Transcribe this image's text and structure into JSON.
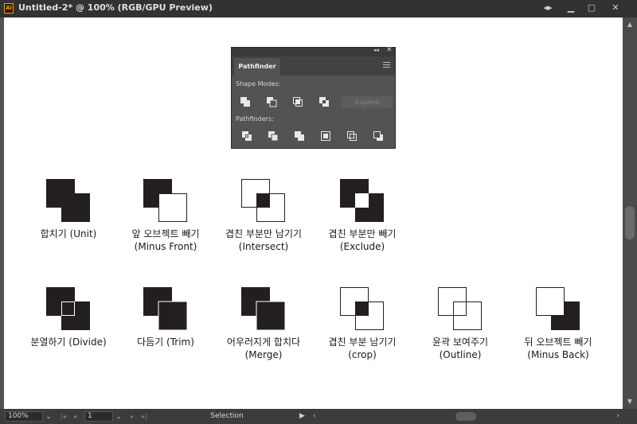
{
  "window": {
    "title": "Untitled-2* @ 100% (RGB/GPU Preview)",
    "app_icon": "Ai",
    "controls": {
      "back": "back-arrows-icon",
      "minimize": "minimize-icon",
      "maximize": "maximize-icon",
      "close": "close-icon"
    }
  },
  "pathfinder": {
    "tab": "Pathfinder",
    "shape_modes_label": "Shape Modes:",
    "pathfinders_label": "Pathfinders:",
    "expand_label": "Expand",
    "shape_mode_buttons": [
      "unite-icon",
      "minus-front-icon",
      "intersect-icon",
      "exclude-icon"
    ],
    "pathfinder_buttons": [
      "divide-icon",
      "trim-icon",
      "merge-icon",
      "crop-icon",
      "outline-icon",
      "minus-back-icon"
    ]
  },
  "examples": {
    "row1": [
      {
        "line1": "합치기 (Unit)",
        "line2": ""
      },
      {
        "line1": "앞 오브젝트 빼기",
        "line2": "(Minus Front)"
      },
      {
        "line1": "겹친 부분만 남기기",
        "line2": "(Intersect)"
      },
      {
        "line1": "겹친 부분만 빼기",
        "line2": "(Exclude)"
      }
    ],
    "row2": [
      {
        "line1": "분열하기 (Divide)",
        "line2": ""
      },
      {
        "line1": "다듬기 (Trim)",
        "line2": ""
      },
      {
        "line1": "어우러지게 합치다",
        "line2": "(Merge)"
      },
      {
        "line1": "겹친 부분 남기기",
        "line2": "(crop)"
      },
      {
        "line1": "윤곽 보여주기",
        "line2": "(Outline)"
      },
      {
        "line1": "뒤 오브젝트 빼기",
        "line2": "(Minus Back)"
      }
    ]
  },
  "statusbar": {
    "zoom": "100%",
    "page": "1",
    "tool": "Selection"
  },
  "colors": {
    "shape_fill": "#231f20",
    "canvas": "#ffffff",
    "ui_bg": "#535353",
    "accent": "#ff9a00"
  }
}
